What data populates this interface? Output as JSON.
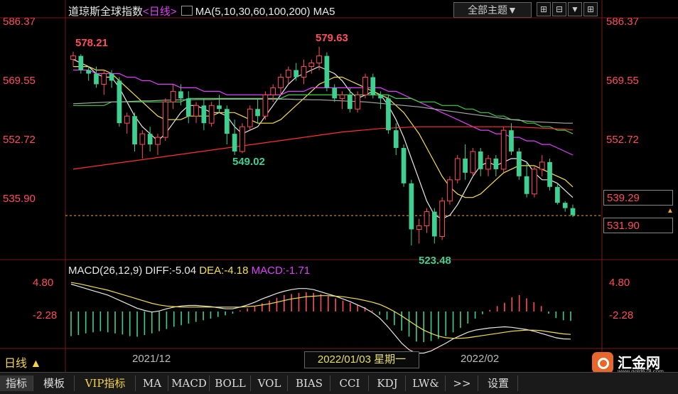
{
  "header": {
    "title": "道琼斯全球指数",
    "period": "<日线>",
    "ma_label": "MA(5,10,30,60,100,200)",
    "ma5_label": "MA5",
    "theme_button": "全部主题▼",
    "tools": [
      "⊞",
      "⊟",
      "▼",
      "⊞",
      "✚"
    ]
  },
  "price_axis": {
    "left": [
      "586.37",
      "569.55",
      "552.72",
      "535.90"
    ],
    "right": [
      "586.37",
      "569.55",
      "552.72"
    ],
    "current_box": "539.29",
    "last_box": "531.90"
  },
  "annotations": {
    "high1": "578.21",
    "high2": "579.63",
    "low1": "549.02",
    "low2": "523.48"
  },
  "macd": {
    "legend_name": "MACD(26,12,9)",
    "diff": "DIFF:-5.04",
    "dea": "DEA:-4.18",
    "macd": "MACD:-1.71",
    "left_ticks": [
      "4.80",
      "-2.28"
    ],
    "right_ticks": [
      "4.80",
      "-2.28"
    ]
  },
  "time_axis": {
    "period_button": "日线 ▲",
    "labels": [
      "2021/12",
      "2022/02"
    ],
    "cursor_date": "2022/01/03 星期一"
  },
  "tabs": [
    "指标",
    "模板",
    "VIP指标",
    "MA",
    "MACD",
    "BOLL",
    "VOL",
    "BIAS",
    "CCI",
    "KDJ",
    "LW&",
    ">>",
    "设置"
  ],
  "logo": {
    "text": "汇金网",
    "sub": "www.gold678.com"
  },
  "colors": {
    "up": "#ff4d5e",
    "down": "#3fcf90",
    "accent": "#f5d34a"
  },
  "chart_data": [
    {
      "type": "candlestick",
      "ylim": [
        523.48,
        586.37
      ],
      "candles": [
        {
          "o": 576,
          "h": 578.21,
          "l": 574,
          "c": 577
        },
        {
          "o": 577,
          "h": 577.5,
          "l": 572,
          "c": 573
        },
        {
          "o": 573,
          "h": 574,
          "l": 570,
          "c": 572
        },
        {
          "o": 572,
          "h": 574,
          "l": 568,
          "c": 569
        },
        {
          "o": 569,
          "h": 573,
          "l": 566,
          "c": 572
        },
        {
          "o": 572,
          "h": 573,
          "l": 568,
          "c": 570
        },
        {
          "o": 570,
          "h": 571,
          "l": 557,
          "c": 558
        },
        {
          "o": 558,
          "h": 561,
          "l": 555,
          "c": 560
        },
        {
          "o": 560,
          "h": 561,
          "l": 550,
          "c": 552
        },
        {
          "o": 552,
          "h": 556,
          "l": 548,
          "c": 555
        },
        {
          "o": 555,
          "h": 557,
          "l": 550,
          "c": 552
        },
        {
          "o": 552,
          "h": 555,
          "l": 549,
          "c": 554
        },
        {
          "o": 554,
          "h": 565,
          "l": 553,
          "c": 564
        },
        {
          "o": 564,
          "h": 569,
          "l": 562,
          "c": 567
        },
        {
          "o": 567,
          "h": 569,
          "l": 563,
          "c": 565
        },
        {
          "o": 565,
          "h": 567,
          "l": 558,
          "c": 560
        },
        {
          "o": 560,
          "h": 564,
          "l": 558,
          "c": 563
        },
        {
          "o": 563,
          "h": 565,
          "l": 556,
          "c": 558
        },
        {
          "o": 558,
          "h": 564,
          "l": 557,
          "c": 563
        },
        {
          "o": 563,
          "h": 566,
          "l": 561,
          "c": 562
        },
        {
          "o": 562,
          "h": 563,
          "l": 552,
          "c": 555
        },
        {
          "o": 555,
          "h": 559,
          "l": 549.02,
          "c": 550
        },
        {
          "o": 550,
          "h": 558,
          "l": 549.5,
          "c": 557
        },
        {
          "o": 557,
          "h": 563,
          "l": 556,
          "c": 562
        },
        {
          "o": 562,
          "h": 565,
          "l": 558,
          "c": 560
        },
        {
          "o": 560,
          "h": 567,
          "l": 559,
          "c": 566
        },
        {
          "o": 566,
          "h": 569,
          "l": 564,
          "c": 568
        },
        {
          "o": 568,
          "h": 572,
          "l": 566,
          "c": 571
        },
        {
          "o": 571,
          "h": 574,
          "l": 569,
          "c": 573
        },
        {
          "o": 573,
          "h": 575,
          "l": 570,
          "c": 571
        },
        {
          "o": 571,
          "h": 576,
          "l": 569,
          "c": 574
        },
        {
          "o": 574,
          "h": 576,
          "l": 572,
          "c": 575
        },
        {
          "o": 575,
          "h": 579.63,
          "l": 573,
          "c": 577
        },
        {
          "o": 577,
          "h": 578,
          "l": 567,
          "c": 568
        },
        {
          "o": 568,
          "h": 569,
          "l": 564,
          "c": 565
        },
        {
          "o": 565,
          "h": 567,
          "l": 562,
          "c": 566
        },
        {
          "o": 566,
          "h": 568,
          "l": 561,
          "c": 562
        },
        {
          "o": 562,
          "h": 567,
          "l": 561,
          "c": 566
        },
        {
          "o": 566,
          "h": 572,
          "l": 565,
          "c": 571
        },
        {
          "o": 571,
          "h": 572,
          "l": 565,
          "c": 566
        },
        {
          "o": 566,
          "h": 567,
          "l": 562,
          "c": 565
        },
        {
          "o": 565,
          "h": 566,
          "l": 555,
          "c": 556
        },
        {
          "o": 556,
          "h": 558,
          "l": 549,
          "c": 551
        },
        {
          "o": 551,
          "h": 552,
          "l": 540,
          "c": 541
        },
        {
          "o": 541,
          "h": 542,
          "l": 523.48,
          "c": 528
        },
        {
          "o": 528,
          "h": 531,
          "l": 524,
          "c": 529
        },
        {
          "o": 529,
          "h": 534,
          "l": 527,
          "c": 533
        },
        {
          "o": 533,
          "h": 534,
          "l": 524,
          "c": 526
        },
        {
          "o": 526,
          "h": 537,
          "l": 525,
          "c": 536
        },
        {
          "o": 536,
          "h": 543,
          "l": 535,
          "c": 542
        },
        {
          "o": 542,
          "h": 549,
          "l": 541,
          "c": 548
        },
        {
          "o": 548,
          "h": 552,
          "l": 542,
          "c": 544
        },
        {
          "o": 544,
          "h": 551,
          "l": 543,
          "c": 550
        },
        {
          "o": 550,
          "h": 551,
          "l": 543,
          "c": 545
        },
        {
          "o": 545,
          "h": 549,
          "l": 543,
          "c": 548
        },
        {
          "o": 548,
          "h": 549,
          "l": 543,
          "c": 545
        },
        {
          "o": 545,
          "h": 557,
          "l": 544,
          "c": 556
        },
        {
          "o": 556,
          "h": 558,
          "l": 549,
          "c": 550
        },
        {
          "o": 550,
          "h": 551,
          "l": 542,
          "c": 543
        },
        {
          "o": 543,
          "h": 547,
          "l": 537,
          "c": 538
        },
        {
          "o": 538,
          "h": 546,
          "l": 537,
          "c": 545
        },
        {
          "o": 545,
          "h": 549,
          "l": 543,
          "c": 547
        },
        {
          "o": 547,
          "h": 548,
          "l": 539,
          "c": 540
        },
        {
          "o": 540,
          "h": 541,
          "l": 535,
          "c": 535.5
        },
        {
          "o": 535.5,
          "h": 536,
          "l": 533,
          "c": 534
        },
        {
          "o": 534,
          "h": 535,
          "l": 531.5,
          "c": 532
        }
      ],
      "ma_lines": [
        {
          "name": "MA5",
          "color": "#e8e8e8",
          "values": [
            576,
            575,
            574,
            572,
            571,
            571,
            568,
            564,
            560,
            557,
            555,
            553,
            555,
            558,
            561,
            563,
            563,
            562,
            561,
            561,
            560,
            557,
            555,
            556,
            557,
            560,
            563,
            566,
            569,
            571,
            572,
            573,
            574,
            573,
            572,
            570,
            567,
            565,
            566,
            567,
            566,
            563,
            559,
            554,
            548,
            542,
            536,
            532,
            531,
            532,
            535,
            539,
            543,
            546,
            547,
            546,
            547,
            548,
            548,
            547,
            544,
            542,
            542,
            541,
            539,
            537
          ]
        },
        {
          "name": "MA10",
          "color": "#f5e04a",
          "values": [
            574,
            574,
            574,
            573,
            573,
            572,
            570,
            568,
            566,
            564,
            562,
            560,
            559,
            559,
            559,
            560,
            560,
            560,
            560,
            561,
            561,
            561,
            560,
            559,
            558,
            558,
            558,
            559,
            561,
            563,
            565,
            567,
            569,
            570,
            571,
            571,
            570,
            569,
            568,
            567,
            566,
            565,
            563,
            561,
            558,
            555,
            551,
            547,
            543,
            540,
            538,
            537,
            537,
            538,
            540,
            542,
            544,
            545,
            546,
            546,
            546,
            545,
            544,
            543,
            542,
            540
          ]
        },
        {
          "name": "MA30",
          "color": "#e040fb",
          "values": [
            573,
            573,
            573,
            572,
            572,
            572,
            572,
            571,
            571,
            570,
            570,
            569,
            569,
            569,
            568,
            568,
            568,
            567,
            567,
            567,
            566,
            566,
            566,
            566,
            566,
            566,
            566,
            566,
            567,
            567,
            567,
            568,
            568,
            568,
            568,
            568,
            568,
            568,
            568,
            568,
            568,
            567,
            567,
            566,
            565,
            564,
            563,
            562,
            561,
            560,
            559,
            558,
            557,
            556,
            556,
            555,
            555,
            554,
            554,
            553,
            553,
            552,
            552,
            551,
            550,
            549
          ]
        },
        {
          "name": "MA60",
          "color": "#3fcf40",
          "values": [
            563,
            563,
            563,
            563,
            563,
            564,
            564,
            564,
            564,
            564,
            564,
            564,
            564,
            564,
            564,
            565,
            565,
            565,
            565,
            565,
            565,
            565,
            565,
            565,
            565,
            565,
            565,
            565,
            566,
            566,
            566,
            566,
            566,
            566,
            566,
            566,
            566,
            566,
            566,
            566,
            566,
            566,
            565,
            565,
            565,
            564,
            564,
            564,
            563,
            563,
            563,
            562,
            562,
            561,
            561,
            560,
            560,
            559,
            559,
            558,
            558,
            557,
            557,
            556,
            556,
            555
          ]
        },
        {
          "name": "MA100",
          "color": "#aaaaaa",
          "values": [
            563.5,
            563.6,
            563.7,
            563.8,
            563.9,
            564,
            564,
            564.1,
            564.2,
            564.3,
            564.3,
            564.4,
            564.5,
            564.5,
            564.6,
            564.6,
            564.7,
            564.7,
            564.7,
            564.8,
            564.8,
            564.8,
            564.8,
            564.8,
            564.8,
            564.8,
            564.8,
            564.8,
            564.8,
            564.7,
            564.7,
            564.6,
            564.6,
            564.5,
            564.4,
            564.3,
            564.2,
            564.1,
            564,
            563.8,
            563.6,
            563.4,
            563.2,
            563,
            562.8,
            562.6,
            562.3,
            562,
            561.7,
            561.4,
            561.1,
            560.8,
            560.5,
            560.2,
            559.9,
            559.6,
            559.3,
            559,
            558.8,
            558.6,
            558.4,
            558.3,
            558.2,
            558.1,
            558,
            558
          ]
        },
        {
          "name": "MA200",
          "color": "#ff3030",
          "values": [
            545,
            545.3,
            545.6,
            545.9,
            546.2,
            546.5,
            546.8,
            547.1,
            547.4,
            547.7,
            548,
            548.3,
            548.6,
            548.9,
            549.2,
            549.5,
            549.8,
            550.1,
            550.4,
            550.7,
            551,
            551.3,
            551.6,
            551.9,
            552.2,
            552.5,
            552.8,
            553.1,
            553.4,
            553.7,
            554,
            554.3,
            554.6,
            554.9,
            555.2,
            555.5,
            555.7,
            555.9,
            556.1,
            556.3,
            556.5,
            556.6,
            556.7,
            556.8,
            556.9,
            557,
            557,
            557,
            557,
            557,
            557,
            557,
            557,
            557,
            557,
            557,
            557,
            557,
            556.9,
            556.8,
            556.7,
            556.6,
            556.5,
            556.4,
            556.3,
            556.1
          ]
        }
      ],
      "last_price": 531.9
    },
    {
      "type": "bar",
      "title": "MACD(26,12,9)",
      "ylim": [
        -6.5,
        6.5
      ],
      "values": [
        -4.5,
        -4.3,
        -4.0,
        -3.8,
        -3.6,
        -3.8,
        -4.0,
        -4.2,
        -4.5,
        -4.6,
        -4.3,
        -4.0,
        -3.6,
        -3.2,
        -2.8,
        -2.5,
        -2.2,
        -1.9,
        -1.6,
        -1.3,
        -1.0,
        -0.7,
        -0.4,
        0.2,
        0.6,
        1.0,
        1.5,
        2.0,
        2.5,
        3.0,
        3.2,
        3.4,
        3.5,
        3.4,
        3.2,
        2.8,
        2.4,
        2.0,
        1.6,
        1.2,
        0.8,
        0.2,
        -0.6,
        -1.5,
        -2.5,
        -3.5,
        -4.6,
        -5.5,
        -5.6,
        -5.4,
        -5.0,
        -4.5,
        -3.8,
        -3.0,
        -2.2,
        -1.3,
        -0.5,
        0.3,
        1.0,
        1.6,
        2.6,
        3.0,
        2.4,
        1.7,
        1.0,
        -0.4,
        -1.2,
        -1.6,
        -1.71
      ],
      "diff": [
        5.0,
        4.6,
        4.2,
        3.8,
        3.4,
        3.0,
        2.4,
        1.8,
        1.2,
        0.6,
        0.2,
        -0.1,
        0.1,
        0.5,
        0.8,
        1.0,
        1.1,
        1.1,
        1.0,
        0.9,
        0.7,
        0.5,
        0.5,
        0.8,
        1.2,
        1.7,
        2.3,
        2.8,
        3.3,
        3.7,
        4.0,
        4.2,
        4.2,
        4.0,
        3.6,
        3.2,
        2.8,
        2.3,
        1.8,
        1.2,
        0.6,
        -0.2,
        -1.2,
        -2.6,
        -4.2,
        -5.8,
        -7.0,
        -7.6,
        -7.6,
        -7.2,
        -6.5,
        -5.8,
        -5.0,
        -4.4,
        -3.8,
        -3.4,
        -3.2,
        -3.0,
        -2.9,
        -2.8,
        -2.9,
        -3.1,
        -3.3,
        -3.6,
        -4.0,
        -4.4,
        -4.8,
        -5.0,
        -5.04
      ],
      "dea": [
        5.3,
        5.1,
        4.8,
        4.5,
        4.2,
        3.9,
        3.5,
        3.1,
        2.7,
        2.3,
        1.9,
        1.5,
        1.2,
        1.0,
        0.9,
        0.8,
        0.8,
        0.8,
        0.8,
        0.8,
        0.8,
        0.8,
        0.8,
        0.8,
        0.9,
        1.0,
        1.2,
        1.4,
        1.7,
        2.0,
        2.3,
        2.5,
        2.7,
        2.8,
        2.9,
        2.9,
        2.8,
        2.7,
        2.5,
        2.3,
        2.0,
        1.7,
        1.3,
        0.7,
        0.0,
        -0.8,
        -1.7,
        -2.6,
        -3.4,
        -4.0,
        -4.5,
        -4.8,
        -4.9,
        -4.9,
        -4.8,
        -4.6,
        -4.4,
        -4.2,
        -4.0,
        -3.8,
        -3.6,
        -3.5,
        -3.4,
        -3.4,
        -3.5,
        -3.7,
        -3.9,
        -4.1,
        -4.18
      ]
    }
  ]
}
